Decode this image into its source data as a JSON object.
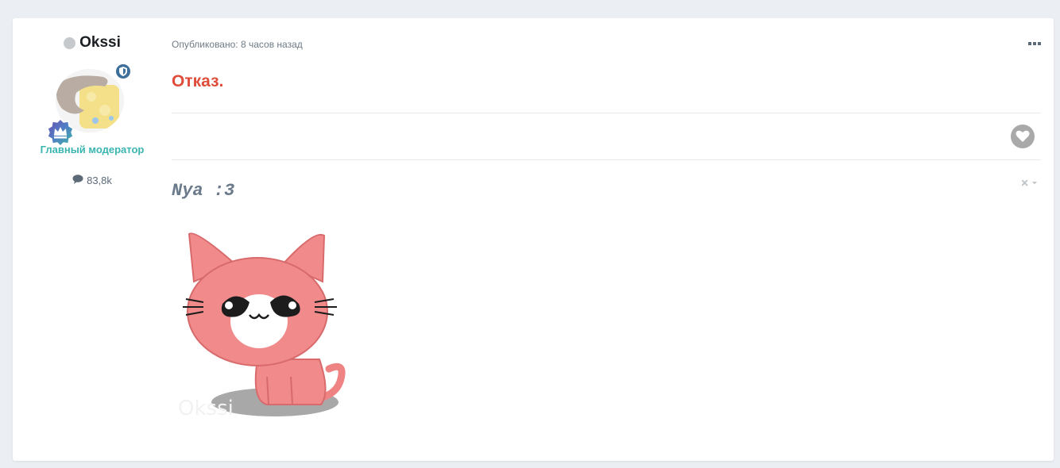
{
  "author": {
    "name": "Okssi",
    "status": "offline",
    "title": "Главный модератор",
    "post_count": "83,8k",
    "icons": {
      "presence": "presence-dot-icon",
      "mod_badge": "shield-icon",
      "rank_badge": "crown-badge-icon",
      "posts": "comment-icon"
    }
  },
  "post": {
    "meta": "Опубликовано: 8 часов назад",
    "body": "Отказ.",
    "menu_icon": "more-horizontal-icon",
    "like_icon": "heart-icon"
  },
  "signature": {
    "text": "Nya :3",
    "image_watermark": "Okssi",
    "controls_icon": "close-dropdown-icon"
  },
  "colors": {
    "title_accent": "#3bb5b0",
    "body_text": "#df4c39",
    "mod_badge": "#3e6f9a"
  }
}
